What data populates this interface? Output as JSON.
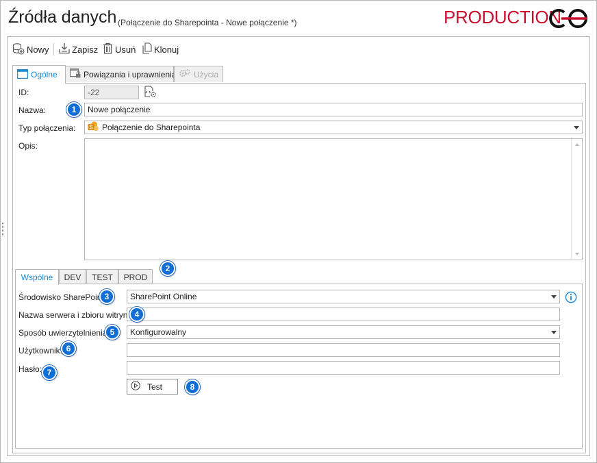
{
  "header": {
    "title": "Źródła danych",
    "subtitle": "(Połączenie do Sharepointa - Nowe połączenie *)",
    "environment": "PRODUCTION",
    "environment_color": "#c8102e"
  },
  "toolbar": {
    "new_label": "Nowy",
    "save_label": "Zapisz",
    "delete_label": "Usuń",
    "clone_label": "Klonuj"
  },
  "tabs": [
    {
      "label": "Ogólne",
      "active": true
    },
    {
      "label": "Powiązania i uprawnienia",
      "active": false
    },
    {
      "label": "Użycia",
      "active": false,
      "disabled": true
    }
  ],
  "form": {
    "id_label": "ID:",
    "id_value": "-22",
    "name_label": "Nazwa:",
    "name_value": "Nowe połączenie",
    "type_label": "Typ połączenia:",
    "type_value": "Połączenie do Sharepointa",
    "description_label": "Opis:",
    "description_value": ""
  },
  "subtabs": [
    {
      "label": "Wspólne",
      "active": true
    },
    {
      "label": "DEV",
      "active": false
    },
    {
      "label": "TEST",
      "active": false
    },
    {
      "label": "PROD",
      "active": false
    }
  ],
  "connection": {
    "environment_label": "Środowisko SharePoint:",
    "environment_value": "SharePoint Online",
    "server_label": "Nazwa serwera i zbioru witryn:",
    "server_value": "",
    "auth_label": "Sposób uwierzytelnienia:",
    "auth_value": "Konfigurowalny",
    "user_label": "Użytkownik:",
    "user_value": "",
    "password_label": "Hasło:",
    "password_value": "",
    "test_label": "Test"
  },
  "badges": [
    "1",
    "2",
    "3",
    "4",
    "5",
    "6",
    "7",
    "8"
  ],
  "colors": {
    "accent": "#1a8ad6",
    "badge": "#0f6fd6"
  }
}
